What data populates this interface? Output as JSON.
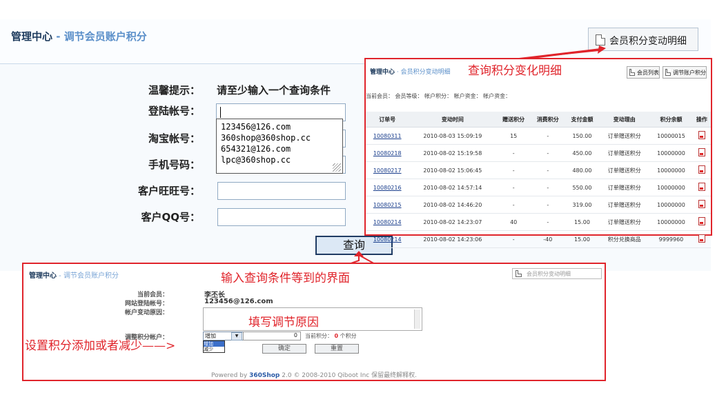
{
  "main": {
    "title": "管理中心",
    "title_sep": " - ",
    "subtitle": "调节会员账户积分",
    "detail_button": "会员积分变动明细",
    "hint_label": "温馨提示：",
    "hint_text": "请至少输入一个查询条件",
    "fields": [
      {
        "label": "登陆帐号："
      },
      {
        "label": "淘宝帐号："
      },
      {
        "label": "手机号码："
      },
      {
        "label": "客户旺旺号："
      },
      {
        "label": "客户QQ号："
      }
    ],
    "autocomplete": [
      "123456@126.com",
      "360shop@360shop.cc",
      "654321@126.com",
      "lpc@360shop.cc"
    ],
    "query_button": "查询"
  },
  "detail_panel": {
    "annotation": "查询积分变化明细",
    "title": "管理中心",
    "subtitle": " · 会员积分变动明细",
    "btn_member_list": "会员列表",
    "btn_adjust": "调节账户积分",
    "info": "当前会员：  会员等级：  帐户积分：  帐户资金：  帐户资金：",
    "headers": [
      "订单号",
      "变动时间",
      "赠送积分",
      "消费积分",
      "支付金额",
      "变动理由",
      "积分余额",
      "操作"
    ],
    "rows": [
      [
        "10080311",
        "2010-08-03 15:09:19",
        "15",
        "-",
        "150.00",
        "订单赠送积分",
        "10000015"
      ],
      [
        "10080218",
        "2010-08-02 15:19:58",
        "-",
        "-",
        "450.00",
        "订单赠送积分",
        "10000000"
      ],
      [
        "10080217",
        "2010-08-02 15:06:45",
        "-",
        "-",
        "480.00",
        "订单赠送积分",
        "10000000"
      ],
      [
        "10080216",
        "2010-08-02 14:57:14",
        "-",
        "-",
        "550.00",
        "订单赠送积分",
        "10000000"
      ],
      [
        "10080215",
        "2010-08-02 14:46:20",
        "-",
        "-",
        "319.00",
        "订单赠送积分",
        "10000000"
      ],
      [
        "10080214",
        "2010-08-02 14:23:07",
        "40",
        "-",
        "15.00",
        "订单赠送积分",
        "10000000"
      ],
      [
        "10080214",
        "2010-08-02 14:23:06",
        "-",
        "-40",
        "15.00",
        "积分兑换商品",
        "9999960"
      ]
    ]
  },
  "result_panel": {
    "annotation": "输入查询条件等到的界面",
    "title": "管理中心",
    "subtitle": " - 调节会员账户积分",
    "detail_button": "会员积分变动明细",
    "current_member_label": "当前会员：",
    "current_member_value": "李丕长",
    "login_label": "网站登陆帐号：",
    "login_value": "123456@126.com",
    "reason_label": "帐户变动原因：",
    "reason_placeholder_annot": "填写调节原因",
    "adjust_label": "调整积分帐户：",
    "select_value": "增加",
    "select_options": [
      "增加",
      "减少"
    ],
    "points_input": "0",
    "current_points_label": "当前积分：",
    "current_points_value": "0",
    "current_points_unit": "个积分",
    "confirm_button": "确定",
    "reset_button": "重置",
    "footer_prefix": "Powered by",
    "footer_brand": "360Shop",
    "footer_suffix": "2.0 © 2008-2010 Qiboot Inc 保留最终解释权."
  },
  "side_annotation": "设置积分添加或者减少——>",
  "colors": {
    "accent_red": "#e0242b",
    "title_blue": "#1d3a5c",
    "sub_blue": "#5b8fc9"
  }
}
